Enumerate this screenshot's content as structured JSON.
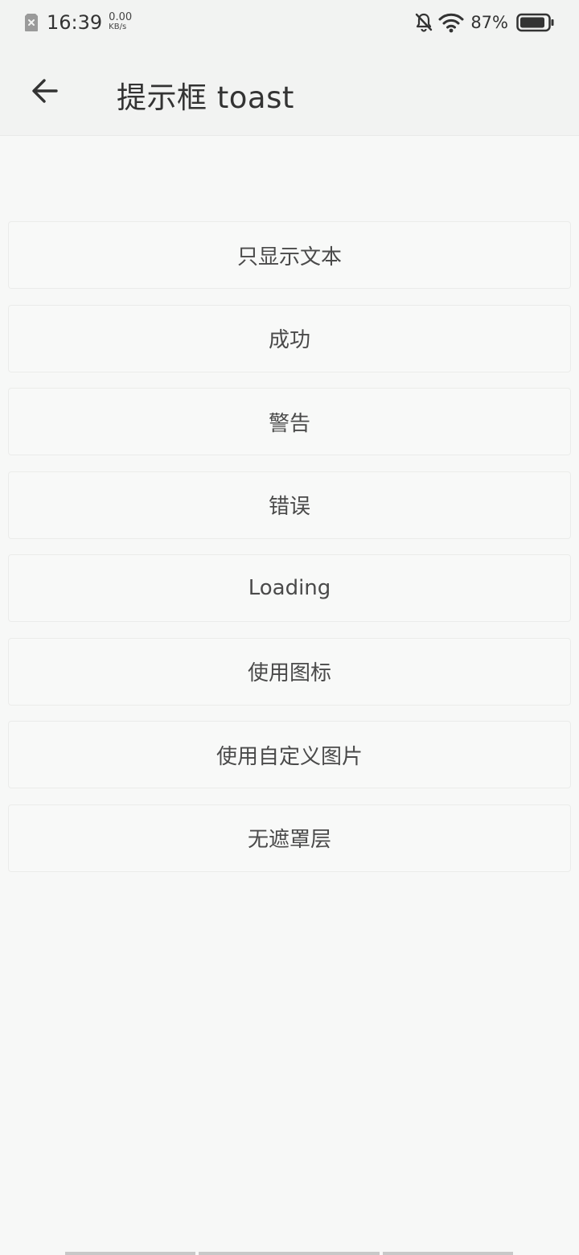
{
  "status_bar": {
    "time": "16:39",
    "net_speed": "0.00",
    "net_unit": "KB/s",
    "battery_percent": "87%"
  },
  "header": {
    "title": "提示框 toast"
  },
  "buttons": [
    {
      "label": "只显示文本"
    },
    {
      "label": "成功"
    },
    {
      "label": "警告"
    },
    {
      "label": "错误"
    },
    {
      "label": "Loading"
    },
    {
      "label": "使用图标"
    },
    {
      "label": "使用自定义图片"
    },
    {
      "label": "无遮罩层"
    }
  ],
  "icons": {
    "back": "arrow-left-icon",
    "sim": "sim-error-icon",
    "silent": "bell-off-icon",
    "wifi": "wifi-icon",
    "battery": "battery-icon"
  },
  "colors": {
    "background": "#f7f8f7",
    "header_background": "#f2f3f2",
    "text": "#333333",
    "button_border": "#ebecea"
  }
}
